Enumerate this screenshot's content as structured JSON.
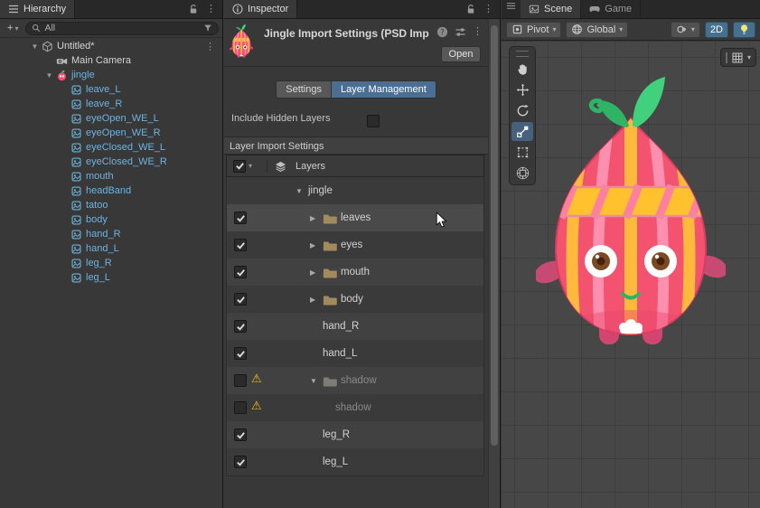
{
  "hierarchy": {
    "tab_label": "Hierarchy",
    "add_button_label": "+",
    "search_value": "All",
    "items": [
      {
        "label": "Untitled*",
        "depth": 0,
        "icon": "scene",
        "fold": "open",
        "kebab": true,
        "style": "plain"
      },
      {
        "label": "Main Camera",
        "depth": 1,
        "icon": "camera",
        "style": "plain"
      },
      {
        "label": "jingle",
        "depth": 1,
        "icon": "jingle",
        "fold": "open",
        "style": "prefab"
      },
      {
        "label": "leave_L",
        "depth": 2,
        "icon": "sprite",
        "style": "prefab"
      },
      {
        "label": "leave_R",
        "depth": 2,
        "icon": "sprite",
        "style": "prefab"
      },
      {
        "label": "eyeOpen_WE_L",
        "depth": 2,
        "icon": "sprite",
        "style": "prefab"
      },
      {
        "label": "eyeOpen_WE_R",
        "depth": 2,
        "icon": "sprite",
        "style": "prefab"
      },
      {
        "label": "eyeClosed_WE_L",
        "depth": 2,
        "icon": "sprite",
        "style": "prefab"
      },
      {
        "label": "eyeClosed_WE_R",
        "depth": 2,
        "icon": "sprite",
        "style": "prefab"
      },
      {
        "label": "mouth",
        "depth": 2,
        "icon": "sprite",
        "style": "prefab"
      },
      {
        "label": "headBand",
        "depth": 2,
        "icon": "sprite",
        "style": "prefab"
      },
      {
        "label": "tatoo",
        "depth": 2,
        "icon": "sprite",
        "style": "prefab"
      },
      {
        "label": "body",
        "depth": 2,
        "icon": "sprite",
        "style": "prefab"
      },
      {
        "label": "hand_R",
        "depth": 2,
        "icon": "sprite",
        "style": "prefab"
      },
      {
        "label": "hand_L",
        "depth": 2,
        "icon": "sprite",
        "style": "prefab"
      },
      {
        "label": "leg_R",
        "depth": 2,
        "icon": "sprite",
        "style": "prefab"
      },
      {
        "label": "leg_L",
        "depth": 2,
        "icon": "sprite",
        "style": "prefab"
      }
    ]
  },
  "inspector": {
    "tab_label": "Inspector",
    "title": "Jingle Import Settings (PSD Imp",
    "open_button_label": "Open",
    "tabs": [
      {
        "label": "Settings",
        "selected": false
      },
      {
        "label": "Layer Management",
        "selected": true
      }
    ],
    "include_hidden_layers_label": "Include Hidden Layers",
    "include_hidden_layers_checked": false,
    "section_title": "Layer Import Settings",
    "layers_column_label": "Layers",
    "rows": [
      {
        "label": "jingle",
        "depth": 0,
        "fold": "open",
        "checkbox": null,
        "folder": false,
        "warning": false,
        "enabled": true,
        "hover": false
      },
      {
        "label": "leaves",
        "depth": 1,
        "fold": "closed",
        "checkbox": true,
        "folder": true,
        "warning": false,
        "enabled": true,
        "hover": true
      },
      {
        "label": "eyes",
        "depth": 1,
        "fold": "closed",
        "checkbox": true,
        "folder": true,
        "warning": false,
        "enabled": true,
        "hover": false
      },
      {
        "label": "mouth",
        "depth": 1,
        "fold": "closed",
        "checkbox": true,
        "folder": true,
        "warning": false,
        "enabled": true,
        "hover": false
      },
      {
        "label": "body",
        "depth": 1,
        "fold": "closed",
        "checkbox": true,
        "folder": true,
        "warning": false,
        "enabled": true,
        "hover": false
      },
      {
        "label": "hand_R",
        "depth": 1,
        "fold": null,
        "checkbox": true,
        "folder": false,
        "warning": false,
        "enabled": true,
        "hover": false
      },
      {
        "label": "hand_L",
        "depth": 1,
        "fold": null,
        "checkbox": true,
        "folder": false,
        "warning": false,
        "enabled": true,
        "hover": false
      },
      {
        "label": "shadow",
        "depth": 1,
        "fold": "open",
        "checkbox": false,
        "folder": true,
        "warning": true,
        "enabled": false,
        "hover": false
      },
      {
        "label": "shadow",
        "depth": 2,
        "fold": null,
        "checkbox": false,
        "folder": false,
        "warning": true,
        "enabled": false,
        "hover": false
      },
      {
        "label": "leg_R",
        "depth": 1,
        "fold": null,
        "checkbox": true,
        "folder": false,
        "warning": false,
        "enabled": true,
        "hover": false
      },
      {
        "label": "leg_L",
        "depth": 1,
        "fold": null,
        "checkbox": true,
        "folder": false,
        "warning": false,
        "enabled": true,
        "hover": false
      }
    ]
  },
  "scene": {
    "scene_tab_label": "Scene",
    "game_tab_label": "Game",
    "pivot_label": "Pivot",
    "global_label": "Global",
    "mode_2d_label": "2D",
    "tools": [
      "view-tool",
      "move-tool",
      "rotate-tool",
      "scale-tool",
      "rect-tool",
      "transform-tool"
    ],
    "selected_tool": "scale-tool",
    "character": "jingle"
  },
  "colors": {
    "panel_bg": "#383838",
    "tabbar_bg": "#282828",
    "selected_blue": "#4c6e93",
    "prefab_text": "#6db3e0",
    "warning_yellow": "#f0c01d"
  }
}
